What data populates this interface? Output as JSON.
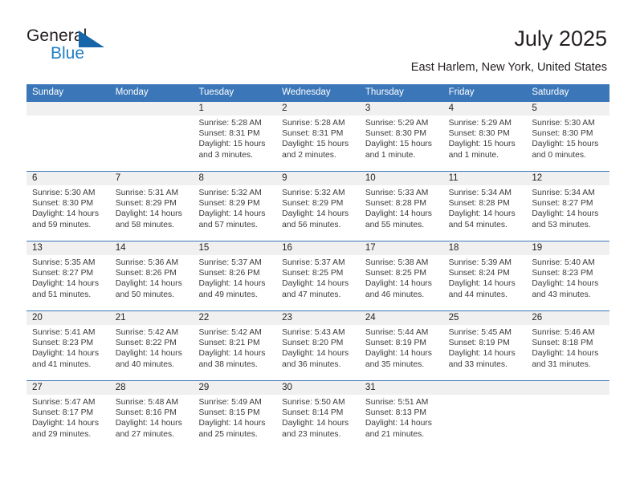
{
  "brand": {
    "name_part1": "General",
    "name_part2": "Blue",
    "triangle_color": "#1565a8",
    "blue_color": "#1f7fc4"
  },
  "header": {
    "title": "July 2025",
    "subtitle": "East Harlem, New York, United States"
  },
  "theme": {
    "header_blue": "#3b77b8",
    "daynum_band": "#f0f0f0",
    "text": "#231f20"
  },
  "weekday_headers": [
    "Sunday",
    "Monday",
    "Tuesday",
    "Wednesday",
    "Thursday",
    "Friday",
    "Saturday"
  ],
  "weeks": [
    [
      {
        "day": "",
        "sunrise": "",
        "sunset": "",
        "daylight1": "",
        "daylight2": ""
      },
      {
        "day": "",
        "sunrise": "",
        "sunset": "",
        "daylight1": "",
        "daylight2": ""
      },
      {
        "day": "1",
        "sunrise": "Sunrise: 5:28 AM",
        "sunset": "Sunset: 8:31 PM",
        "daylight1": "Daylight: 15 hours",
        "daylight2": "and 3 minutes."
      },
      {
        "day": "2",
        "sunrise": "Sunrise: 5:28 AM",
        "sunset": "Sunset: 8:31 PM",
        "daylight1": "Daylight: 15 hours",
        "daylight2": "and 2 minutes."
      },
      {
        "day": "3",
        "sunrise": "Sunrise: 5:29 AM",
        "sunset": "Sunset: 8:30 PM",
        "daylight1": "Daylight: 15 hours",
        "daylight2": "and 1 minute."
      },
      {
        "day": "4",
        "sunrise": "Sunrise: 5:29 AM",
        "sunset": "Sunset: 8:30 PM",
        "daylight1": "Daylight: 15 hours",
        "daylight2": "and 1 minute."
      },
      {
        "day": "5",
        "sunrise": "Sunrise: 5:30 AM",
        "sunset": "Sunset: 8:30 PM",
        "daylight1": "Daylight: 15 hours",
        "daylight2": "and 0 minutes."
      }
    ],
    [
      {
        "day": "6",
        "sunrise": "Sunrise: 5:30 AM",
        "sunset": "Sunset: 8:30 PM",
        "daylight1": "Daylight: 14 hours",
        "daylight2": "and 59 minutes."
      },
      {
        "day": "7",
        "sunrise": "Sunrise: 5:31 AM",
        "sunset": "Sunset: 8:29 PM",
        "daylight1": "Daylight: 14 hours",
        "daylight2": "and 58 minutes."
      },
      {
        "day": "8",
        "sunrise": "Sunrise: 5:32 AM",
        "sunset": "Sunset: 8:29 PM",
        "daylight1": "Daylight: 14 hours",
        "daylight2": "and 57 minutes."
      },
      {
        "day": "9",
        "sunrise": "Sunrise: 5:32 AM",
        "sunset": "Sunset: 8:29 PM",
        "daylight1": "Daylight: 14 hours",
        "daylight2": "and 56 minutes."
      },
      {
        "day": "10",
        "sunrise": "Sunrise: 5:33 AM",
        "sunset": "Sunset: 8:28 PM",
        "daylight1": "Daylight: 14 hours",
        "daylight2": "and 55 minutes."
      },
      {
        "day": "11",
        "sunrise": "Sunrise: 5:34 AM",
        "sunset": "Sunset: 8:28 PM",
        "daylight1": "Daylight: 14 hours",
        "daylight2": "and 54 minutes."
      },
      {
        "day": "12",
        "sunrise": "Sunrise: 5:34 AM",
        "sunset": "Sunset: 8:27 PM",
        "daylight1": "Daylight: 14 hours",
        "daylight2": "and 53 minutes."
      }
    ],
    [
      {
        "day": "13",
        "sunrise": "Sunrise: 5:35 AM",
        "sunset": "Sunset: 8:27 PM",
        "daylight1": "Daylight: 14 hours",
        "daylight2": "and 51 minutes."
      },
      {
        "day": "14",
        "sunrise": "Sunrise: 5:36 AM",
        "sunset": "Sunset: 8:26 PM",
        "daylight1": "Daylight: 14 hours",
        "daylight2": "and 50 minutes."
      },
      {
        "day": "15",
        "sunrise": "Sunrise: 5:37 AM",
        "sunset": "Sunset: 8:26 PM",
        "daylight1": "Daylight: 14 hours",
        "daylight2": "and 49 minutes."
      },
      {
        "day": "16",
        "sunrise": "Sunrise: 5:37 AM",
        "sunset": "Sunset: 8:25 PM",
        "daylight1": "Daylight: 14 hours",
        "daylight2": "and 47 minutes."
      },
      {
        "day": "17",
        "sunrise": "Sunrise: 5:38 AM",
        "sunset": "Sunset: 8:25 PM",
        "daylight1": "Daylight: 14 hours",
        "daylight2": "and 46 minutes."
      },
      {
        "day": "18",
        "sunrise": "Sunrise: 5:39 AM",
        "sunset": "Sunset: 8:24 PM",
        "daylight1": "Daylight: 14 hours",
        "daylight2": "and 44 minutes."
      },
      {
        "day": "19",
        "sunrise": "Sunrise: 5:40 AM",
        "sunset": "Sunset: 8:23 PM",
        "daylight1": "Daylight: 14 hours",
        "daylight2": "and 43 minutes."
      }
    ],
    [
      {
        "day": "20",
        "sunrise": "Sunrise: 5:41 AM",
        "sunset": "Sunset: 8:23 PM",
        "daylight1": "Daylight: 14 hours",
        "daylight2": "and 41 minutes."
      },
      {
        "day": "21",
        "sunrise": "Sunrise: 5:42 AM",
        "sunset": "Sunset: 8:22 PM",
        "daylight1": "Daylight: 14 hours",
        "daylight2": "and 40 minutes."
      },
      {
        "day": "22",
        "sunrise": "Sunrise: 5:42 AM",
        "sunset": "Sunset: 8:21 PM",
        "daylight1": "Daylight: 14 hours",
        "daylight2": "and 38 minutes."
      },
      {
        "day": "23",
        "sunrise": "Sunrise: 5:43 AM",
        "sunset": "Sunset: 8:20 PM",
        "daylight1": "Daylight: 14 hours",
        "daylight2": "and 36 minutes."
      },
      {
        "day": "24",
        "sunrise": "Sunrise: 5:44 AM",
        "sunset": "Sunset: 8:19 PM",
        "daylight1": "Daylight: 14 hours",
        "daylight2": "and 35 minutes."
      },
      {
        "day": "25",
        "sunrise": "Sunrise: 5:45 AM",
        "sunset": "Sunset: 8:19 PM",
        "daylight1": "Daylight: 14 hours",
        "daylight2": "and 33 minutes."
      },
      {
        "day": "26",
        "sunrise": "Sunrise: 5:46 AM",
        "sunset": "Sunset: 8:18 PM",
        "daylight1": "Daylight: 14 hours",
        "daylight2": "and 31 minutes."
      }
    ],
    [
      {
        "day": "27",
        "sunrise": "Sunrise: 5:47 AM",
        "sunset": "Sunset: 8:17 PM",
        "daylight1": "Daylight: 14 hours",
        "daylight2": "and 29 minutes."
      },
      {
        "day": "28",
        "sunrise": "Sunrise: 5:48 AM",
        "sunset": "Sunset: 8:16 PM",
        "daylight1": "Daylight: 14 hours",
        "daylight2": "and 27 minutes."
      },
      {
        "day": "29",
        "sunrise": "Sunrise: 5:49 AM",
        "sunset": "Sunset: 8:15 PM",
        "daylight1": "Daylight: 14 hours",
        "daylight2": "and 25 minutes."
      },
      {
        "day": "30",
        "sunrise": "Sunrise: 5:50 AM",
        "sunset": "Sunset: 8:14 PM",
        "daylight1": "Daylight: 14 hours",
        "daylight2": "and 23 minutes."
      },
      {
        "day": "31",
        "sunrise": "Sunrise: 5:51 AM",
        "sunset": "Sunset: 8:13 PM",
        "daylight1": "Daylight: 14 hours",
        "daylight2": "and 21 minutes."
      },
      {
        "day": "",
        "sunrise": "",
        "sunset": "",
        "daylight1": "",
        "daylight2": ""
      },
      {
        "day": "",
        "sunrise": "",
        "sunset": "",
        "daylight1": "",
        "daylight2": ""
      }
    ]
  ]
}
